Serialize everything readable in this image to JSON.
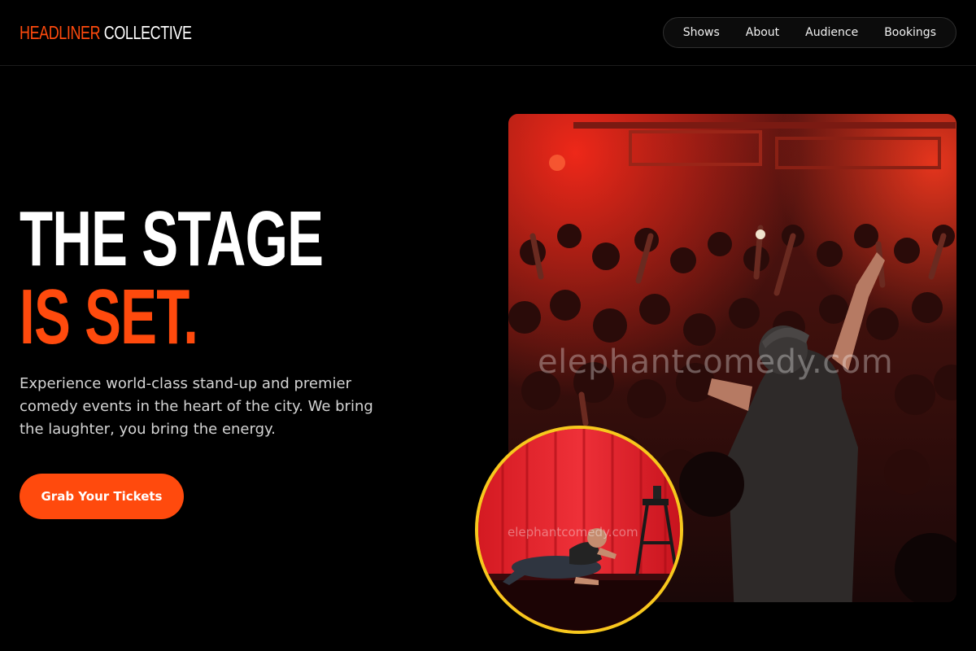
{
  "brand": {
    "accent_text": "HEADLINER",
    "rest_text": "COLLECTIVE",
    "accent_color": "#ff4a0d"
  },
  "nav": {
    "items": [
      {
        "label": "Shows"
      },
      {
        "label": "About"
      },
      {
        "label": "Audience"
      },
      {
        "label": "Bookings"
      }
    ]
  },
  "hero": {
    "title_line1": "THE STAGE",
    "title_line2": "IS SET.",
    "description": "Experience world-class stand-up and premier comedy events in the heart of the city. We bring the laughter, you bring the energy.",
    "cta_label": "Grab Your Tickets"
  },
  "media": {
    "main_photo_watermark": "elephantcomedy.com",
    "inset_photo_watermark": "elephantcomedy.com",
    "inset_border_color": "#f7c81d"
  }
}
